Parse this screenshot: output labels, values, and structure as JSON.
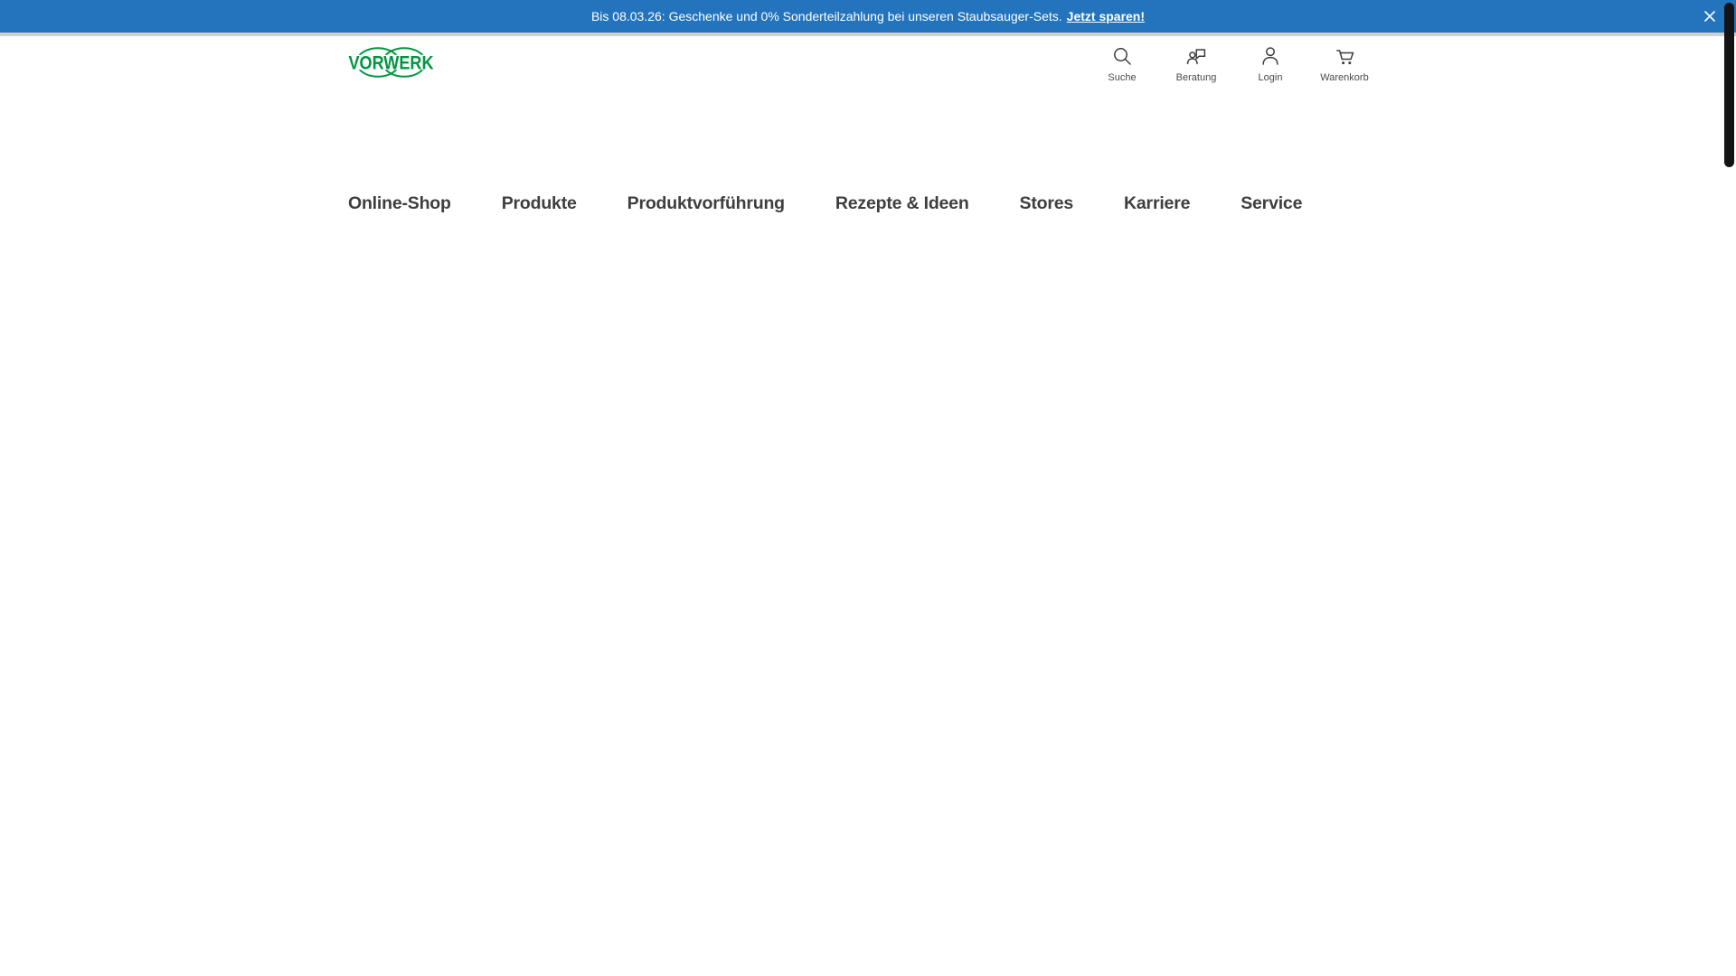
{
  "banner": {
    "message": "Bis 08.03.26: Geschenke und 0% Sonderteilzahlung bei unseren Staubsauger-Sets.",
    "link_label": "Jetzt sparen!",
    "background_color": "#2374BC"
  },
  "header": {
    "logo_text": "VORWERK",
    "logo_color": "#009640",
    "actions": [
      {
        "label": "Suche",
        "icon": "search-icon"
      },
      {
        "label": "Beratung",
        "icon": "consultation-icon"
      },
      {
        "label": "Login",
        "icon": "user-icon"
      },
      {
        "label": "Warenkorb",
        "icon": "cart-icon"
      }
    ]
  },
  "nav": {
    "items": [
      {
        "label": "Online-Shop"
      },
      {
        "label": "Produkte"
      },
      {
        "label": "Produktvorführung"
      },
      {
        "label": "Rezepte & Ideen"
      },
      {
        "label": "Stores"
      },
      {
        "label": "Karriere"
      },
      {
        "label": "Service"
      }
    ]
  }
}
